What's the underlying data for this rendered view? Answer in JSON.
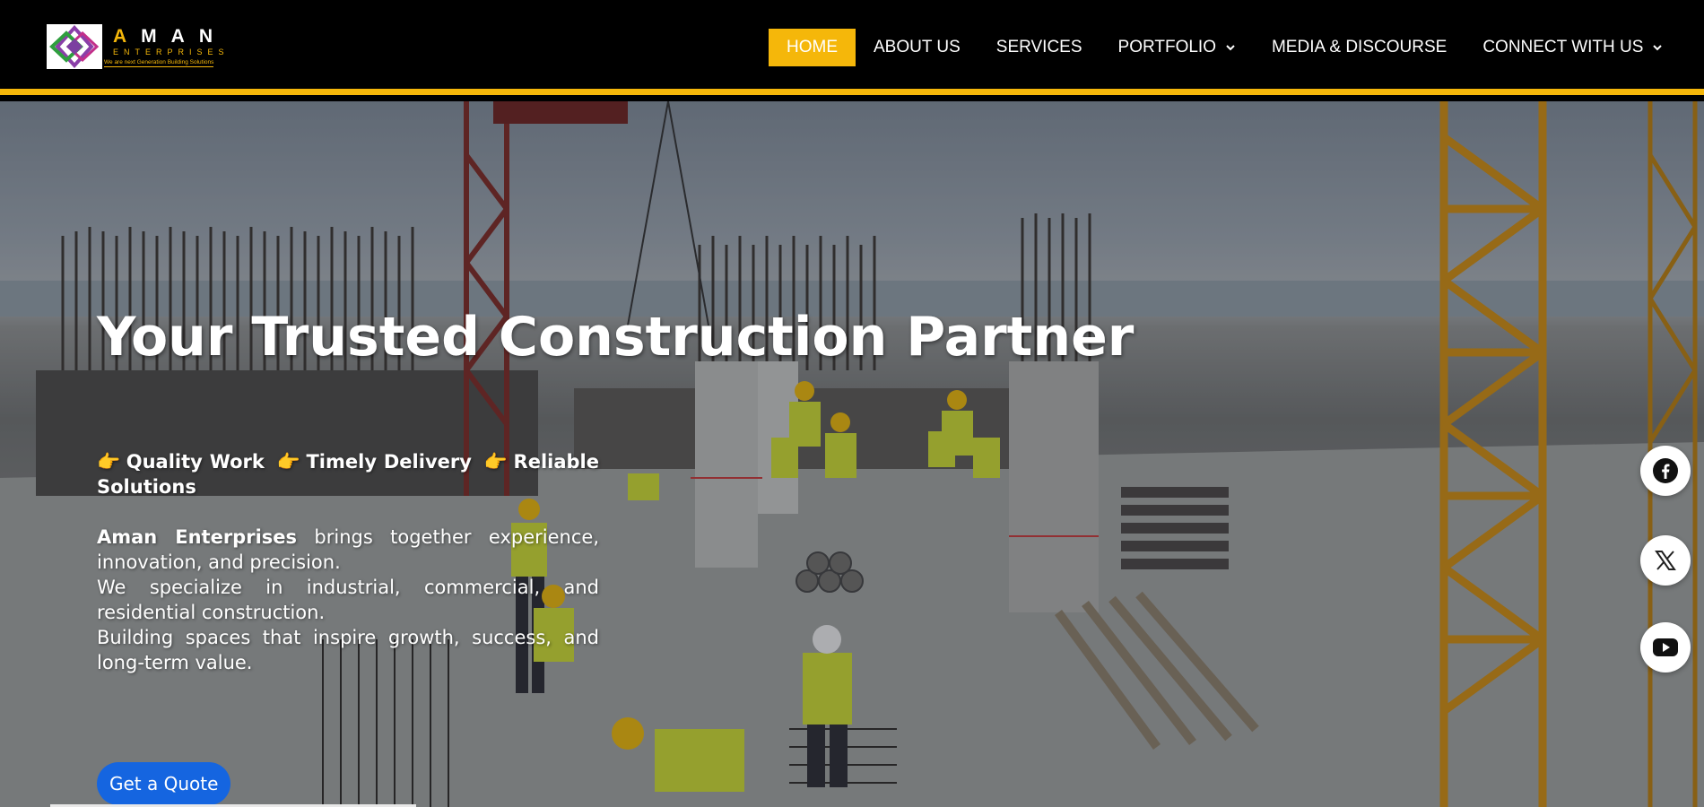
{
  "brand": {
    "name_letters": "AMAN",
    "name_sub": "ENTERPRISES",
    "tagline": "We are next Generation Building Solutions",
    "accent_color": "#f5b70a"
  },
  "nav": {
    "items": [
      {
        "label": "HOME",
        "active": true
      },
      {
        "label": "ABOUT US"
      },
      {
        "label": "SERVICES"
      },
      {
        "label": "PORTFOLIO",
        "dropdown": true
      },
      {
        "label": "MEDIA & DISCOURSE"
      },
      {
        "label": "CONNECT WITH US",
        "dropdown": true
      }
    ]
  },
  "hero": {
    "title": "Your Trusted Construction Partner",
    "points": [
      "Quality Work",
      "Timely Delivery",
      "Reliable Solutions"
    ],
    "point_icon": "pointing-hand-icon",
    "company_name": "Aman Enterprises",
    "body_1_rest": "brings together experience, innovation, and precision.",
    "body_2": "We specialize in industrial, commercial, and residential construction.",
    "body_3": "Building spaces that inspire growth, success, and long-term value.",
    "cta_label": "Get a Quote",
    "cta_color": "#1565e0"
  },
  "social": [
    {
      "name": "facebook-icon"
    },
    {
      "name": "x-twitter-icon"
    },
    {
      "name": "youtube-icon"
    }
  ]
}
